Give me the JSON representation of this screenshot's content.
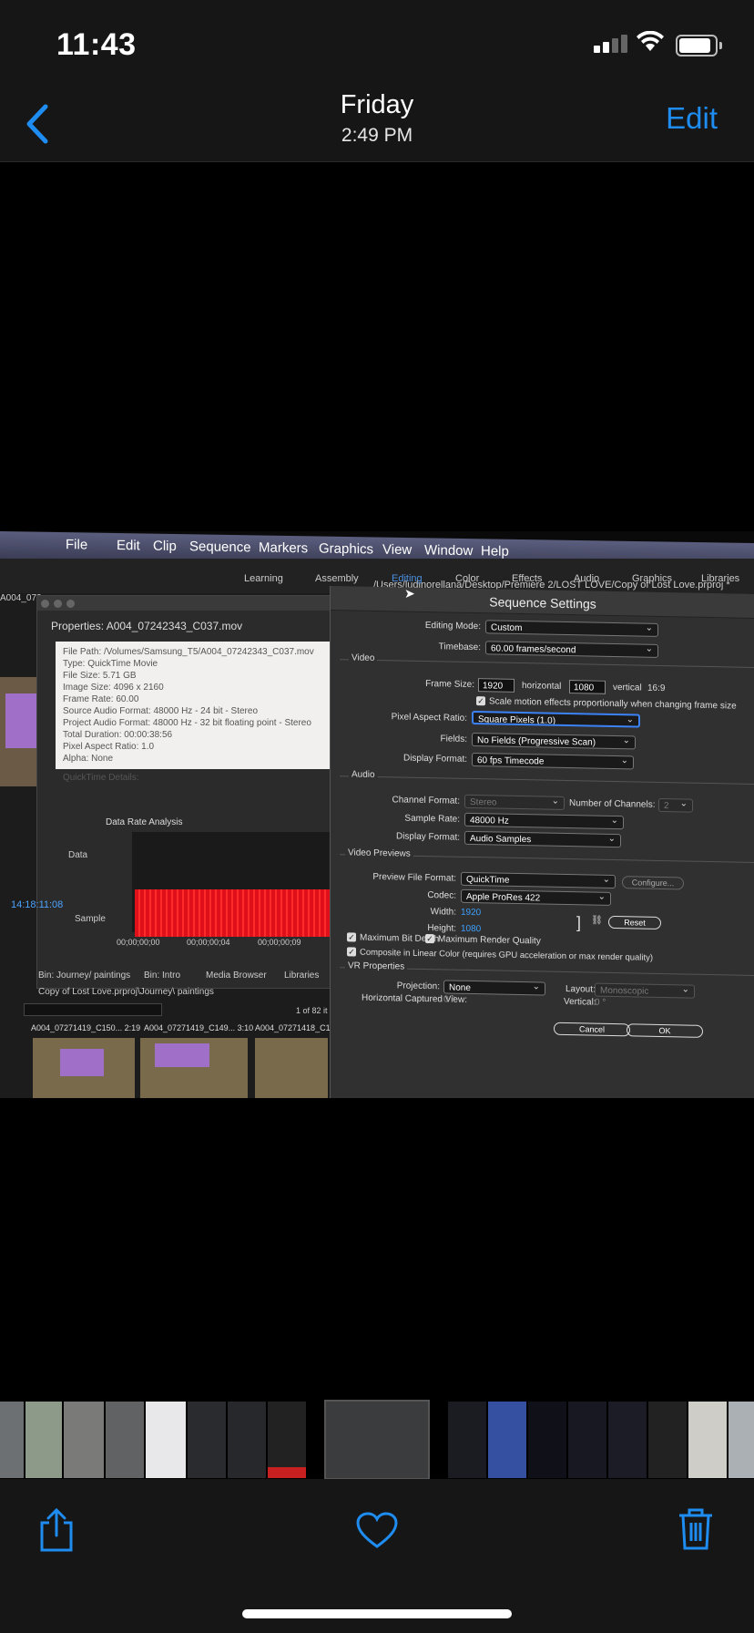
{
  "status_bar": {
    "time": "11:43"
  },
  "nav": {
    "back_label": "",
    "title": "Friday",
    "subtitle": "2:49 PM",
    "edit_label": "Edit"
  },
  "photo": {
    "menu": [
      "File",
      "Edit",
      "Clip",
      "Sequence",
      "Markers",
      "Graphics",
      "View",
      "Window",
      "Help"
    ],
    "project_path": "/Users/ludinorellana/Desktop/Premiere 2/LOST LOVE/Copy of Lost Love.prproj *",
    "workspaces": [
      "Learning",
      "Assembly",
      "Editing",
      "Color",
      "Effects",
      "Audio",
      "Graphics",
      "Libraries"
    ],
    "left_tab": "A004_072",
    "properties": {
      "title": "Properties: A004_07242343_C037.mov",
      "lines": [
        "File Path: /Volumes/Samsung_T5/A004_07242343_C037.mov",
        "Type: QuickTime Movie",
        "File Size: 5.71 GB",
        "Image Size: 4096 x 2160",
        "Frame Rate: 60.00",
        "Source Audio Format: 48000 Hz - 24 bit - Stereo",
        "Project Audio Format: 48000 Hz - 32 bit floating point - Stereo",
        "Total Duration: 00:00:38:56",
        "Pixel Aspect Ratio: 1.0",
        "Alpha: None",
        "",
        "QuickTime Details:"
      ],
      "data_rate_title": "Data Rate Analysis",
      "data_label": "Data",
      "sample_label": "Sample",
      "timecode": "14:18:11:08",
      "ticks": [
        "00;00;00;00",
        "00;00;00;04",
        "00;00;00;09"
      ]
    },
    "bin": {
      "tabs": [
        "Bin: Journey/ paintings",
        "Bin: Intro",
        "Media Browser",
        "Libraries"
      ],
      "path": "Copy of Lost Love.prproj\\Journey\\ paintings",
      "count": "1 of 82 it",
      "clips": [
        "A004_07271419_C150... 2:19",
        "A004_07271419_C149... 3:10",
        "A004_07271418_C14"
      ]
    },
    "dialog": {
      "title": "Sequence Settings",
      "editing_mode_label": "Editing Mode:",
      "editing_mode": "Custom",
      "timebase_label": "Timebase:",
      "timebase": "60.00  frames/second",
      "video_section": "Video",
      "frame_size_label": "Frame Size:",
      "frame_w": "1920",
      "horizontal_label": "horizontal",
      "frame_h": "1080",
      "vertical_label": "vertical",
      "aspect": "16:9",
      "scale_motion_label": "Scale motion effects proportionally when changing frame size",
      "par_label": "Pixel Aspect Ratio:",
      "par": "Square Pixels (1.0)",
      "fields_label": "Fields:",
      "fields": "No Fields (Progressive Scan)",
      "display_format_label": "Display Format:",
      "display_format": "60 fps Timecode",
      "audio_section": "Audio",
      "channel_format_label": "Channel Format:",
      "channel_format": "Stereo",
      "num_channels_label": "Number of Channels:",
      "num_channels": "2",
      "sample_rate_label": "Sample Rate:",
      "sample_rate": "48000 Hz",
      "audio_display_format_label": "Display Format:",
      "audio_display_format": "Audio Samples",
      "previews_section": "Video Previews",
      "preview_format_label": "Preview File Format:",
      "preview_format": "QuickTime",
      "configure_label": "Configure...",
      "codec_label": "Codec:",
      "codec": "Apple ProRes 422",
      "width_label": "Width:",
      "width": "1920",
      "height_label": "Height:",
      "height": "1080",
      "reset_label": "Reset",
      "max_bit_depth_label": "Maximum Bit Depth",
      "max_render_label": "Maximum Render Quality",
      "composite_label": "Composite in Linear Color (requires GPU acceleration or max render quality)",
      "vr_section": "VR Properties",
      "projection_label": "Projection:",
      "projection": "None",
      "layout_label": "Layout:",
      "layout": "Monoscopic",
      "hcv_label": "Horizontal Captured View:",
      "hcv": "0 °",
      "vertical_label2": "Vertical:",
      "vertical_val": "0 °",
      "cancel_label": "Cancel",
      "ok_label": "OK"
    }
  },
  "colors": {
    "accent": "#1e8cf0",
    "background": "#000000",
    "bar": "#161616",
    "red_bars": "#e0101a"
  }
}
